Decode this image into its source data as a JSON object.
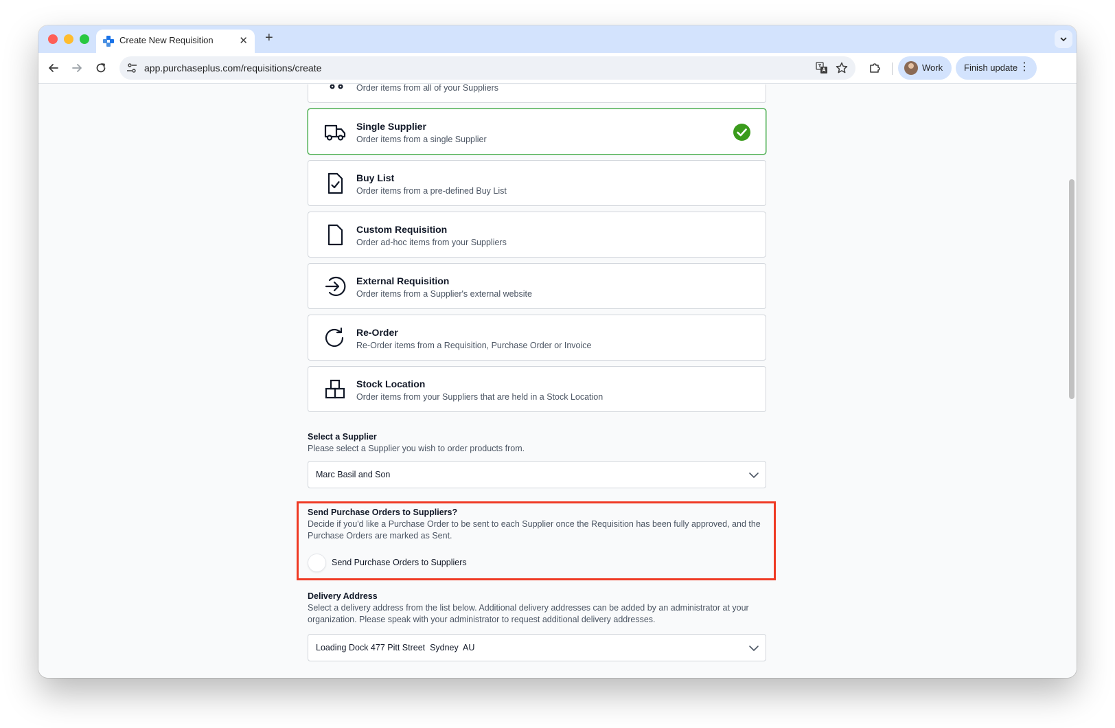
{
  "browser": {
    "tab_title": "Create New Requisition",
    "url": "app.purchaseplus.com/requisitions/create",
    "profile_label": "Work",
    "update_label": "Finish update",
    "new_tab_symbol": "+",
    "close_tab_symbol": "✕",
    "menu_symbol": "⋮"
  },
  "colors": {
    "tabstrip": "#d3e3fd",
    "selected_border": "#4caf50",
    "check_green": "#3a9b1c",
    "highlight_red": "#ef3a24"
  },
  "options": [
    {
      "title": "",
      "desc": "Order items from all of your Suppliers",
      "icon": "cart-icon",
      "selected": false
    },
    {
      "title": "Single Supplier",
      "desc": "Order items from a single Supplier",
      "icon": "truck-icon",
      "selected": true
    },
    {
      "title": "Buy List",
      "desc": "Order items from a pre-defined Buy List",
      "icon": "document-check-icon",
      "selected": false
    },
    {
      "title": "Custom Requisition",
      "desc": "Order ad-hoc items from your Suppliers",
      "icon": "document-icon",
      "selected": false
    },
    {
      "title": "External Requisition",
      "desc": "Order items from a Supplier's external website",
      "icon": "arrow-right-circle-icon",
      "selected": false
    },
    {
      "title": "Re-Order",
      "desc": "Re-Order items from a Requisition, Purchase Order or Invoice",
      "icon": "refresh-icon",
      "selected": false
    },
    {
      "title": "Stock Location",
      "desc": "Order items from your Suppliers that are held in a Stock Location",
      "icon": "boxes-icon",
      "selected": false
    }
  ],
  "supplier": {
    "label": "Select a Supplier",
    "help": "Please select a Supplier you wish to order products from.",
    "value": "Marc Basil and Son"
  },
  "send_po": {
    "label": "Send Purchase Orders to Suppliers?",
    "help": "Decide if you'd like a Purchase Order to be sent to each Supplier once the Requisition has been fully approved, and the Purchase Orders are marked as Sent.",
    "toggle_label": "Send Purchase Orders to Suppliers",
    "toggle_on": false
  },
  "delivery": {
    "label": "Delivery Address",
    "help": "Select a delivery address from the list below. Additional delivery addresses can be added by an administrator at your organization. Please speak with your administrator to request additional delivery addresses.",
    "value": "Loading Dock 477 Pitt Street  Sydney  AU"
  }
}
